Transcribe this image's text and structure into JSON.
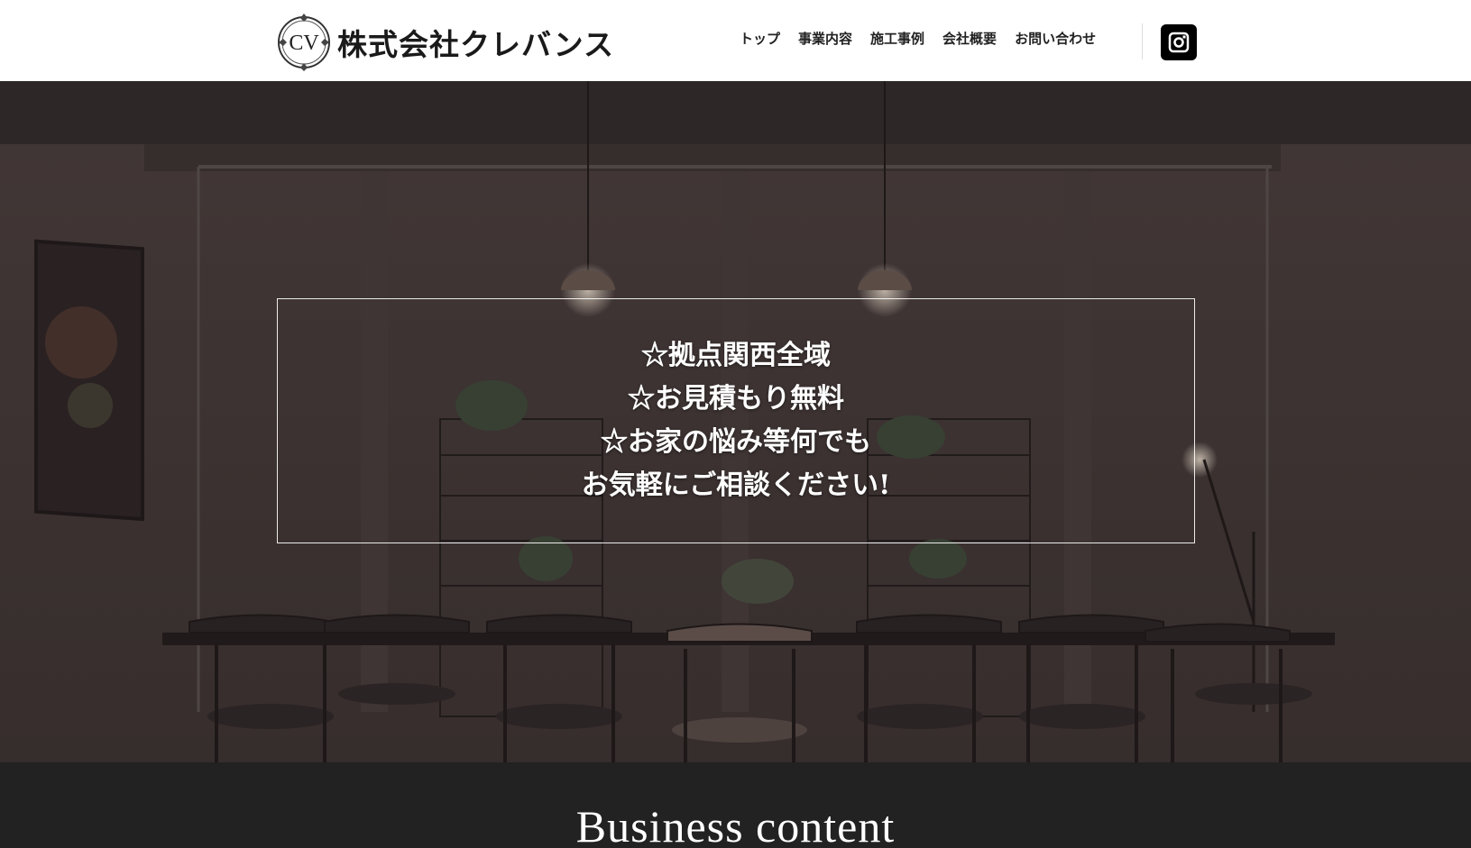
{
  "header": {
    "logo_monogram": "CV",
    "company_name": "株式会社クレバンス",
    "nav": [
      "トップ",
      "事業内容",
      "施工事例",
      "会社概要",
      "お問い合わせ"
    ],
    "instagram_icon": "instagram-icon"
  },
  "hero": {
    "lines": [
      "☆拠点関西全域",
      "☆お見積もり無料",
      "☆お家の悩み等何でも",
      "お気軽にご相談ください!"
    ]
  },
  "section": {
    "title": "Business content"
  },
  "colors": {
    "header_bg": "#ffffff",
    "nav_text": "#222222",
    "hero_overlay": "#3c3332",
    "section_bg": "#222222",
    "hero_text": "#ffffff"
  }
}
